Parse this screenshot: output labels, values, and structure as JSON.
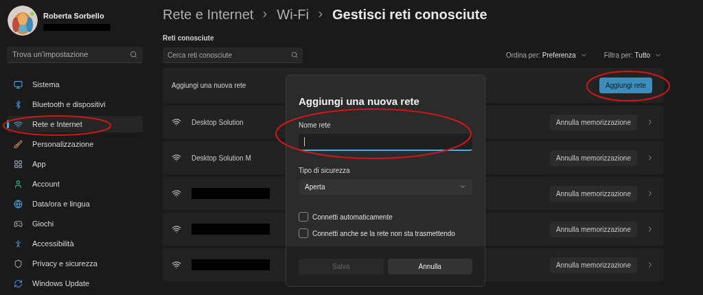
{
  "user": {
    "name": "Roberta Sorbello",
    "email_redacted": true
  },
  "sidebar": {
    "search": {
      "placeholder": "Trova un’impostazione"
    },
    "items": [
      {
        "label": "Sistema",
        "selected": false
      },
      {
        "label": "Bluetooth e dispositivi",
        "selected": false
      },
      {
        "label": "Rete e Internet",
        "selected": true
      },
      {
        "label": "Personalizzazione",
        "selected": false
      },
      {
        "label": "App",
        "selected": false
      },
      {
        "label": "Account",
        "selected": false
      },
      {
        "label": "Data/ora e lingua",
        "selected": false
      },
      {
        "label": "Giochi",
        "selected": false
      },
      {
        "label": "Accessibilità",
        "selected": false
      },
      {
        "label": "Privacy e sicurezza",
        "selected": false
      },
      {
        "label": "Windows Update",
        "selected": false
      }
    ]
  },
  "breadcrumb": [
    "Rete e Internet",
    "Wi-Fi",
    "Gestisci reti conosciute"
  ],
  "section_title": "Reti conosciute",
  "search": {
    "placeholder": "Cerca reti conosciute"
  },
  "sort": {
    "label": "Ordina per:",
    "value": "Preferenza"
  },
  "filter": {
    "label": "Filtra per:",
    "value": "Tutto"
  },
  "add_row": {
    "label": "Aggiungi una nuova rete",
    "button": "Aggiungi rete"
  },
  "networks": [
    {
      "name": "Desktop Solution",
      "redacted": false,
      "button": "Annulla memorizzazione"
    },
    {
      "name": "Desktop Solution M",
      "redacted": false,
      "button": "Annulla memorizzazione"
    },
    {
      "redacted": true,
      "button": "Annulla memorizzazione"
    },
    {
      "redacted": true,
      "button": "Annulla memorizzazione"
    },
    {
      "redacted": true,
      "button": "Annulla memorizzazione"
    }
  ],
  "dialog": {
    "title": "Aggiungi una nuova rete",
    "name_field": {
      "label": "Nome rete",
      "focused": true
    },
    "security": {
      "label": "Tipo di sicurezza",
      "value": "Aperta"
    },
    "options": [
      {
        "label": "Connetti automaticamente",
        "checked": false
      },
      {
        "label": "Connetti anche se la rete non sta trasmettendo",
        "checked": false
      }
    ],
    "buttons": [
      {
        "label": "Salva",
        "disabled": true
      },
      {
        "label": "Annulla",
        "disabled": false
      }
    ]
  }
}
